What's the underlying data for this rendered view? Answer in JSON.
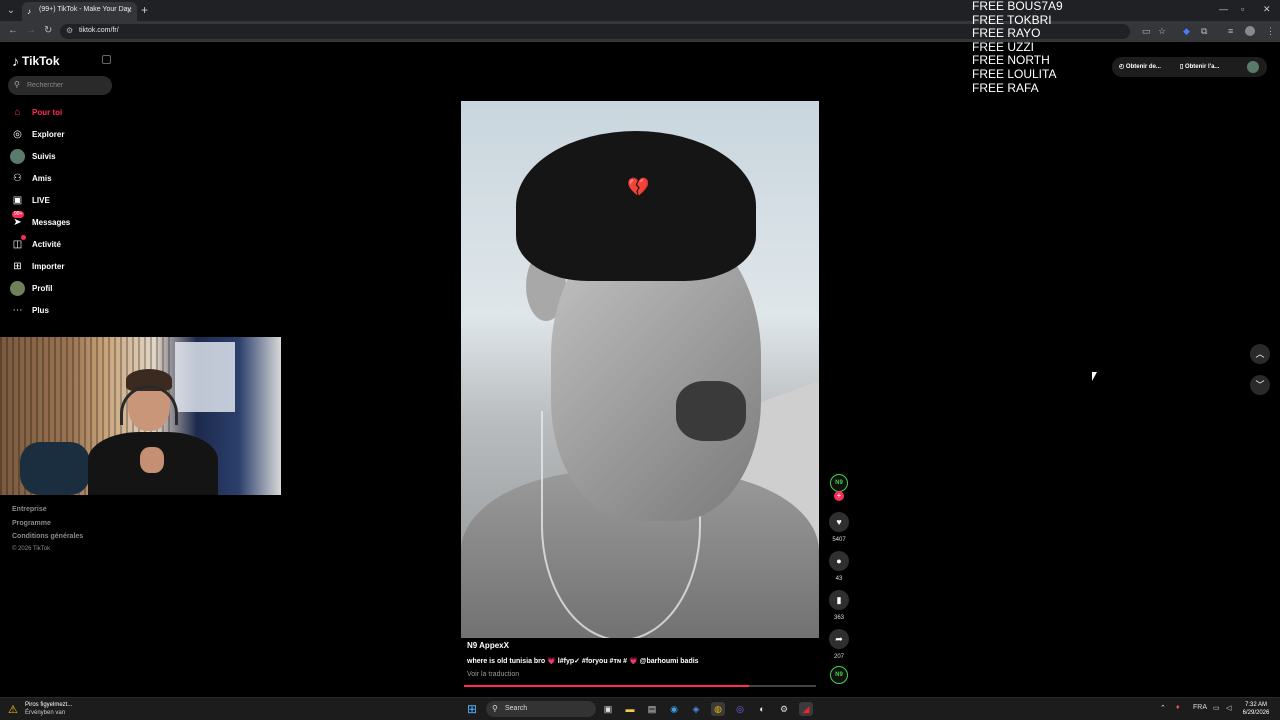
{
  "browser": {
    "tab_title": "(99+) TikTok - Make Your Day",
    "url": "tiktok.com/fr/",
    "new_tab_glyph": "+",
    "close_glyph": "×"
  },
  "overlay_text": [
    "FREE BOUS7A9",
    "FREE TOKBRI",
    "FREE RAYO",
    "FREE UZZI",
    "FREE NORTH",
    "FREE LOULITA",
    "FREE RAFA"
  ],
  "tiktok": {
    "logo": "TikTok",
    "search_placeholder": "Rechercher",
    "nav": [
      {
        "label": "Pour toi",
        "icon": "home-icon",
        "glyph": "⌂",
        "active": true
      },
      {
        "label": "Explorer",
        "icon": "compass-icon",
        "glyph": "◎"
      },
      {
        "label": "Suivis",
        "icon": "following-avatar-icon",
        "glyph": ""
      },
      {
        "label": "Amis",
        "icon": "friends-icon",
        "glyph": "⚇"
      },
      {
        "label": "LIVE",
        "icon": "live-icon",
        "glyph": "▣"
      },
      {
        "label": "Messages",
        "icon": "messages-icon",
        "glyph": "➤",
        "badge": "99+"
      },
      {
        "label": "Activité",
        "icon": "activity-icon",
        "glyph": "◫"
      },
      {
        "label": "Importer",
        "icon": "upload-icon",
        "glyph": "⊞"
      },
      {
        "label": "Profil",
        "icon": "profile-avatar-icon",
        "glyph": ""
      },
      {
        "label": "Plus",
        "icon": "more-icon",
        "glyph": "⋯"
      }
    ],
    "footer": [
      "Entreprise",
      "Programme",
      "Conditions générales"
    ],
    "copyright": "© 2026 TikTok",
    "get_app": {
      "desktop": "Obtenir de...",
      "mobile": "Obtenir l'a..."
    },
    "video": {
      "author": "N9 AppexX",
      "caption": "where is old tunisia bro 💗 l#fyp✓ #foryou #ᴛɴ # 💗 @barhoumi badis",
      "translate": "Voir la traduction",
      "progress": 0.81,
      "avatar_text": "N9"
    },
    "actions": [
      {
        "name": "like",
        "icon": "heart-icon",
        "glyph": "♥",
        "count": "5407"
      },
      {
        "name": "comment",
        "icon": "comment-icon",
        "glyph": "●",
        "count": "43"
      },
      {
        "name": "bookmark",
        "icon": "bookmark-icon",
        "glyph": "▮",
        "count": "363"
      },
      {
        "name": "share",
        "icon": "share-icon",
        "glyph": "➦",
        "count": "207"
      }
    ],
    "scroll": {
      "up": "︿",
      "down": "﹀"
    }
  },
  "taskbar": {
    "notification_title": "Piros figyelmezt...",
    "notification_sub": "Érvényben van",
    "search": "Search",
    "tray_lang": "FRA",
    "time": "7:32 AM",
    "date": "6/29/2026"
  },
  "colors": {
    "accent": "#fe2c55",
    "background": "#000000",
    "chrome": "#35363a"
  }
}
